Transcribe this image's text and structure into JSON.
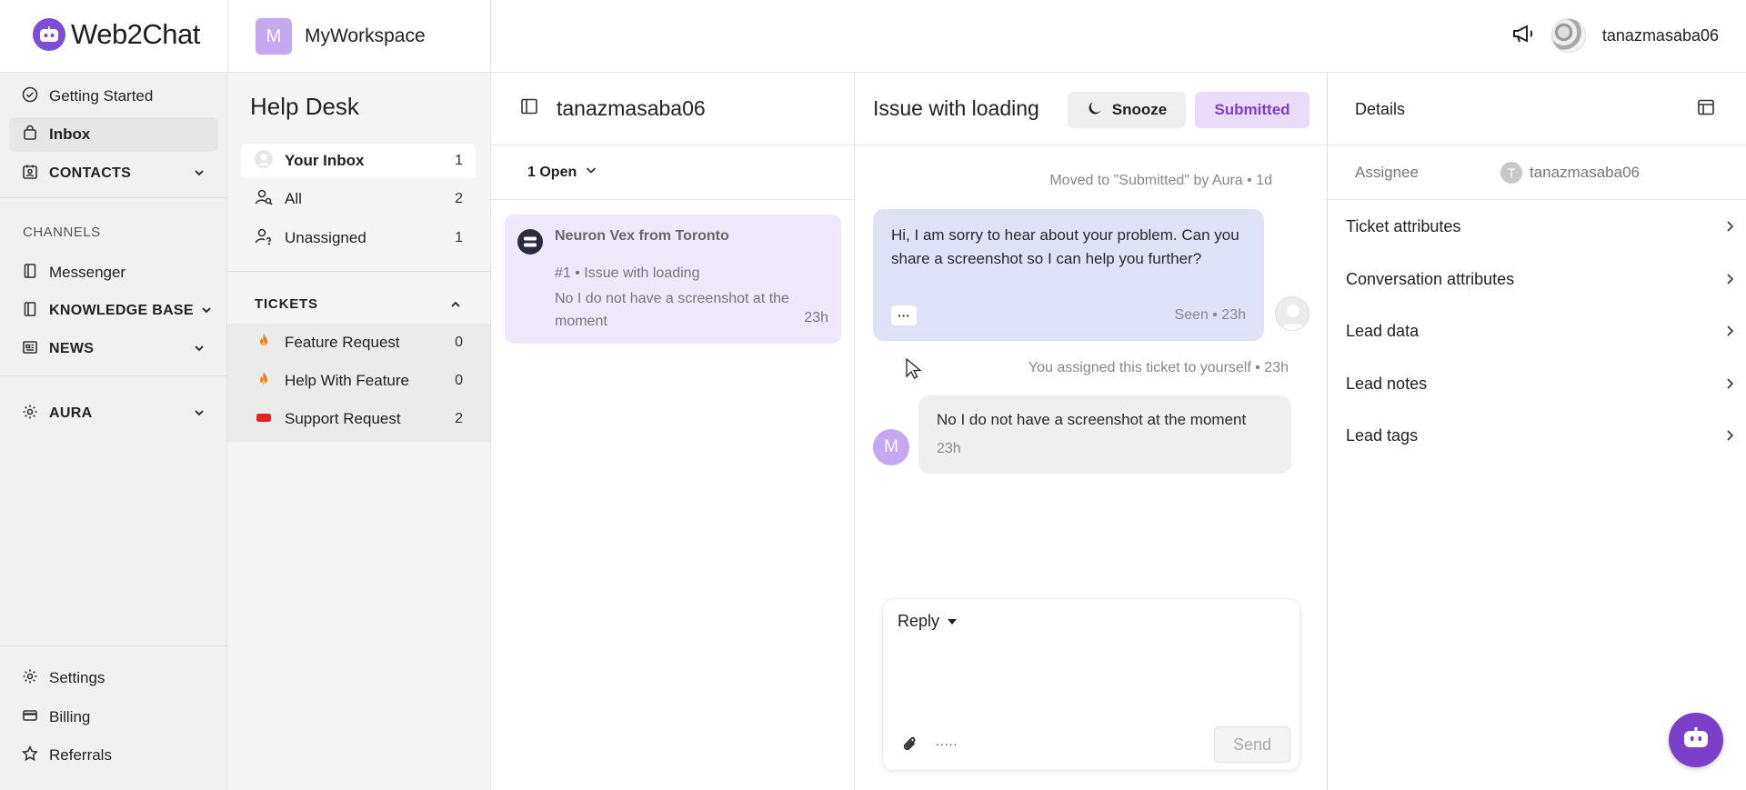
{
  "app": {
    "logo_text": "Web2Chat",
    "brand_color": "#7c4ddb"
  },
  "workspace": {
    "initial": "M",
    "name": "MyWorkspace"
  },
  "topbar": {
    "username": "tanazmasaba06"
  },
  "sidebar": {
    "items": [
      {
        "label": "Getting Started",
        "icon": "check-circle-icon"
      },
      {
        "label": "Inbox",
        "icon": "inbox-icon",
        "active": true
      },
      {
        "label": "CONTACTS",
        "icon": "contacts-icon"
      }
    ],
    "channels_label": "CHANNELS",
    "channels": [
      {
        "label": "Messenger",
        "icon": "book-icon"
      },
      {
        "label": "KNOWLEDGE BASE",
        "icon": "book-icon"
      },
      {
        "label": "NEWS",
        "icon": "newspaper-icon"
      }
    ],
    "aura_label": "AURA",
    "bottom": [
      {
        "label": "Settings",
        "icon": "gear-icon"
      },
      {
        "label": "Billing",
        "icon": "card-icon"
      },
      {
        "label": "Referrals",
        "icon": "star-icon"
      }
    ]
  },
  "helpdesk": {
    "title": "Help Desk",
    "views": [
      {
        "label": "Your Inbox",
        "count": "1"
      },
      {
        "label": "All",
        "count": "2"
      },
      {
        "label": "Unassigned",
        "count": "1"
      }
    ],
    "tickets_label": "TICKETS",
    "tickets": [
      {
        "label": "Feature Request",
        "count": "0"
      },
      {
        "label": "Help With Feature",
        "count": "0"
      },
      {
        "label": "Support Request",
        "count": "2"
      }
    ]
  },
  "convlist": {
    "title": "tanazmasaba06",
    "filter": "1 Open",
    "card": {
      "name": "Neuron Vex from Toronto",
      "subject": "#1 • Issue with loading",
      "preview": "No I do not have a screenshot at the moment",
      "time": "23h"
    }
  },
  "conversation": {
    "title": "Issue with loading",
    "snooze_label": "Snooze",
    "status_label": "Submitted",
    "system_1": "Moved to \"Submitted\" by Aura • 1d",
    "agent_message": "Hi, I am sorry to hear about your problem. Can you share a screenshot so I can help you further?",
    "agent_more": "···",
    "agent_seen": "Seen • 23h",
    "system_2": "You assigned this ticket to yourself • 23h",
    "user_initial": "M",
    "user_message": "No I do not have a screenshot at the moment",
    "user_time": "23h",
    "reply_mode": "Reply",
    "toolbar_dots": ".....",
    "send_label": "Send"
  },
  "details": {
    "title": "Details",
    "assignee_label": "Assignee",
    "assignee_initial": "T",
    "assignee_name": "tanazmasaba06",
    "sections": [
      "Ticket attributes",
      "Conversation attributes",
      "Lead data",
      "Lead notes",
      "Lead tags"
    ]
  }
}
